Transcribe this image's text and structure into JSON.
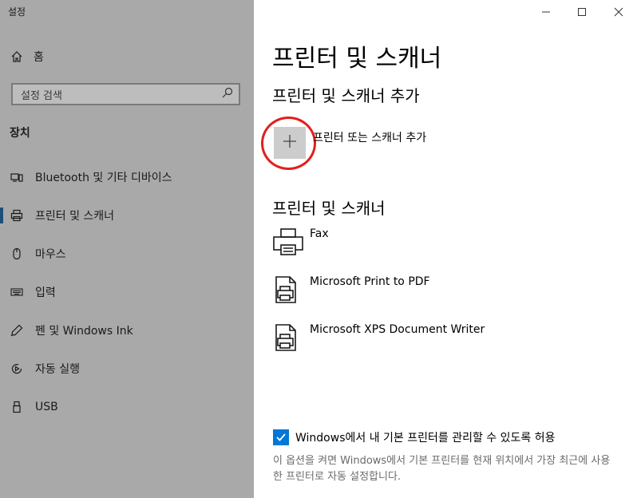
{
  "window": {
    "title": "설정"
  },
  "sidebar": {
    "home_label": "홈",
    "search_placeholder": "설정 검색",
    "section_label": "장치",
    "items": [
      {
        "label": "Bluetooth 및 기타 디바이스",
        "icon": "bluetooth-icon",
        "active": false
      },
      {
        "label": "프린터 및 스캐너",
        "icon": "printer-icon",
        "active": true
      },
      {
        "label": "마우스",
        "icon": "mouse-icon",
        "active": false
      },
      {
        "label": "입력",
        "icon": "keyboard-icon",
        "active": false
      },
      {
        "label": "펜 및 Windows Ink",
        "icon": "pen-icon",
        "active": false
      },
      {
        "label": "자동 실행",
        "icon": "autoplay-icon",
        "active": false
      },
      {
        "label": "USB",
        "icon": "usb-icon",
        "active": false
      }
    ]
  },
  "main": {
    "title": "프린터 및 스캐너",
    "add_section_heading": "프린터 및 스캐너 추가",
    "add_button_label": "프린터 또는 스캐너 추가",
    "list_heading": "프린터 및 스캐너",
    "printers": [
      {
        "name": "Fax",
        "icon": "printer-icon"
      },
      {
        "name": "Microsoft Print to PDF",
        "icon": "document-printer-icon"
      },
      {
        "name": "Microsoft XPS Document Writer",
        "icon": "document-printer-icon"
      }
    ],
    "default_printer_checkbox": {
      "label": "Windows에서 내 기본 프린터를 관리할 수 있도록 허용",
      "checked": true
    },
    "help_text": "이 옵션을 켜면 Windows에서 기본 프린터를 현재 위치에서 가장 최근에 사용한 프린터로 자동 설정합니다."
  },
  "colors": {
    "sidebar_bg": "#a9a9a9",
    "accent": "#0078d7",
    "annotation": "#e41e1e"
  }
}
